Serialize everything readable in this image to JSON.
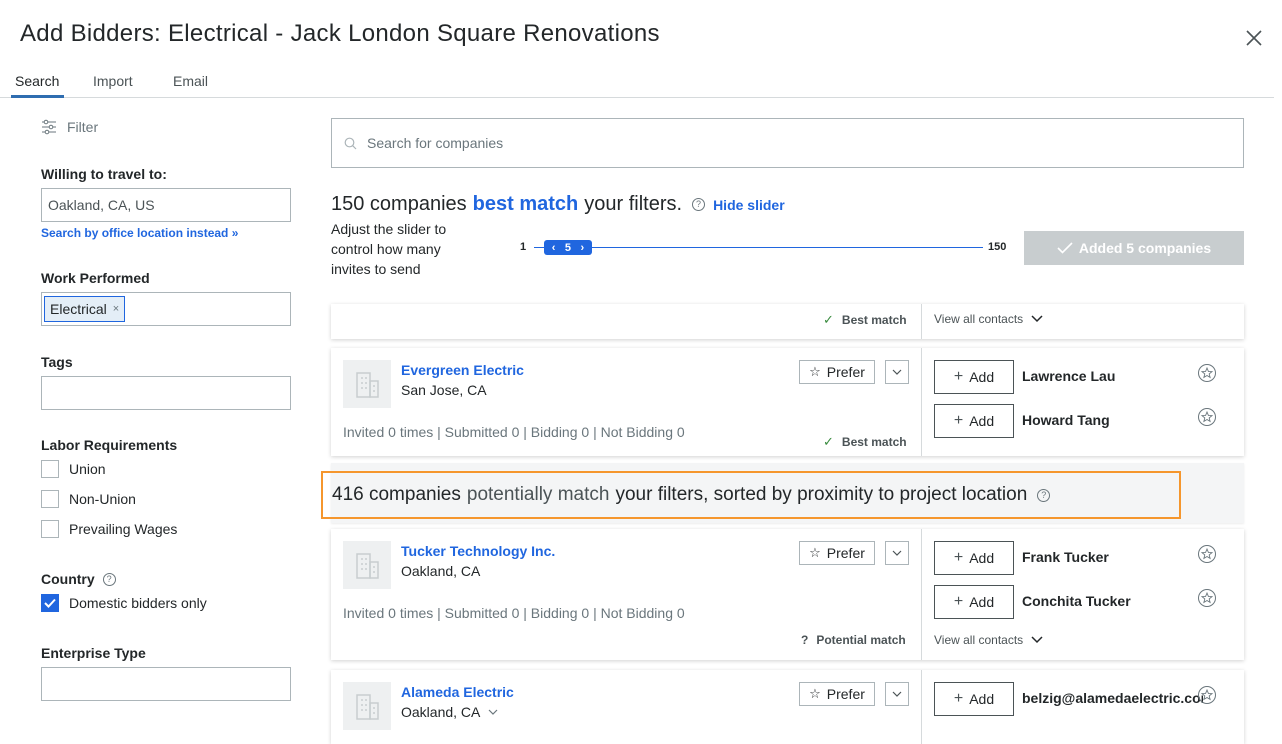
{
  "dialog": {
    "title": "Add Bidders: Electrical - Jack London Square Renovations",
    "close_icon": "close-icon"
  },
  "tabs": [
    {
      "label": "Search",
      "active": true
    },
    {
      "label": "Import",
      "active": false
    },
    {
      "label": "Email",
      "active": false
    }
  ],
  "sidebar": {
    "filter_label": "Filter",
    "travel_label": "Willing to travel to:",
    "travel_value": "Oakland, CA, US",
    "office_link": "Search by office location instead »",
    "work_label": "Work Performed",
    "work_chip": "Electrical",
    "chip_remove": "×",
    "tags_label": "Tags",
    "labor_label": "Labor Requirements",
    "labor_options": [
      "Union",
      "Non-Union",
      "Prevailing Wages"
    ],
    "country_label": "Country",
    "help_glyph": "?",
    "domestic_label": "Domestic bidders only",
    "domestic_checked": true,
    "enterprise_label": "Enterprise Type"
  },
  "search": {
    "placeholder": "Search for companies"
  },
  "best": {
    "count_text": "150 companies",
    "highlight": "best match",
    "suffix": "your filters.",
    "hide_slider": "Hide slider",
    "slider_desc": "Adjust the slider to control how many invites to send",
    "slider_min": "1",
    "slider_max": "150",
    "slider_value": "5",
    "slider_left_glyph": "‹",
    "slider_right_glyph": "›",
    "added_button": "Added 5 companies"
  },
  "labels": {
    "prefer": "Prefer",
    "add": "Add",
    "view_all": "View all contacts",
    "best_match": "Best match",
    "potential_match": "Potential match"
  },
  "companies": [
    {
      "name": "Evergreen Electric",
      "location": "San Jose, CA",
      "stats": "Invited 0 times | Submitted 0 | Bidding 0 | Not Bidding 0",
      "contacts": [
        "Lawrence Lau",
        "Howard Tang"
      ]
    },
    {
      "name": "Tucker Technology Inc.",
      "location": "Oakland, CA",
      "stats": "Invited 0 times | Submitted 0 | Bidding 0 | Not Bidding 0",
      "contacts": [
        "Frank Tucker",
        "Conchita Tucker"
      ]
    },
    {
      "name": "Alameda Electric",
      "location": "Oakland, CA",
      "contacts": [
        "belzig@alamedaelectric.com"
      ]
    }
  ],
  "potential": {
    "count_text": "416 companies",
    "highlight": "potentially match",
    "suffix": "your filters, sorted by proximity to project location"
  }
}
